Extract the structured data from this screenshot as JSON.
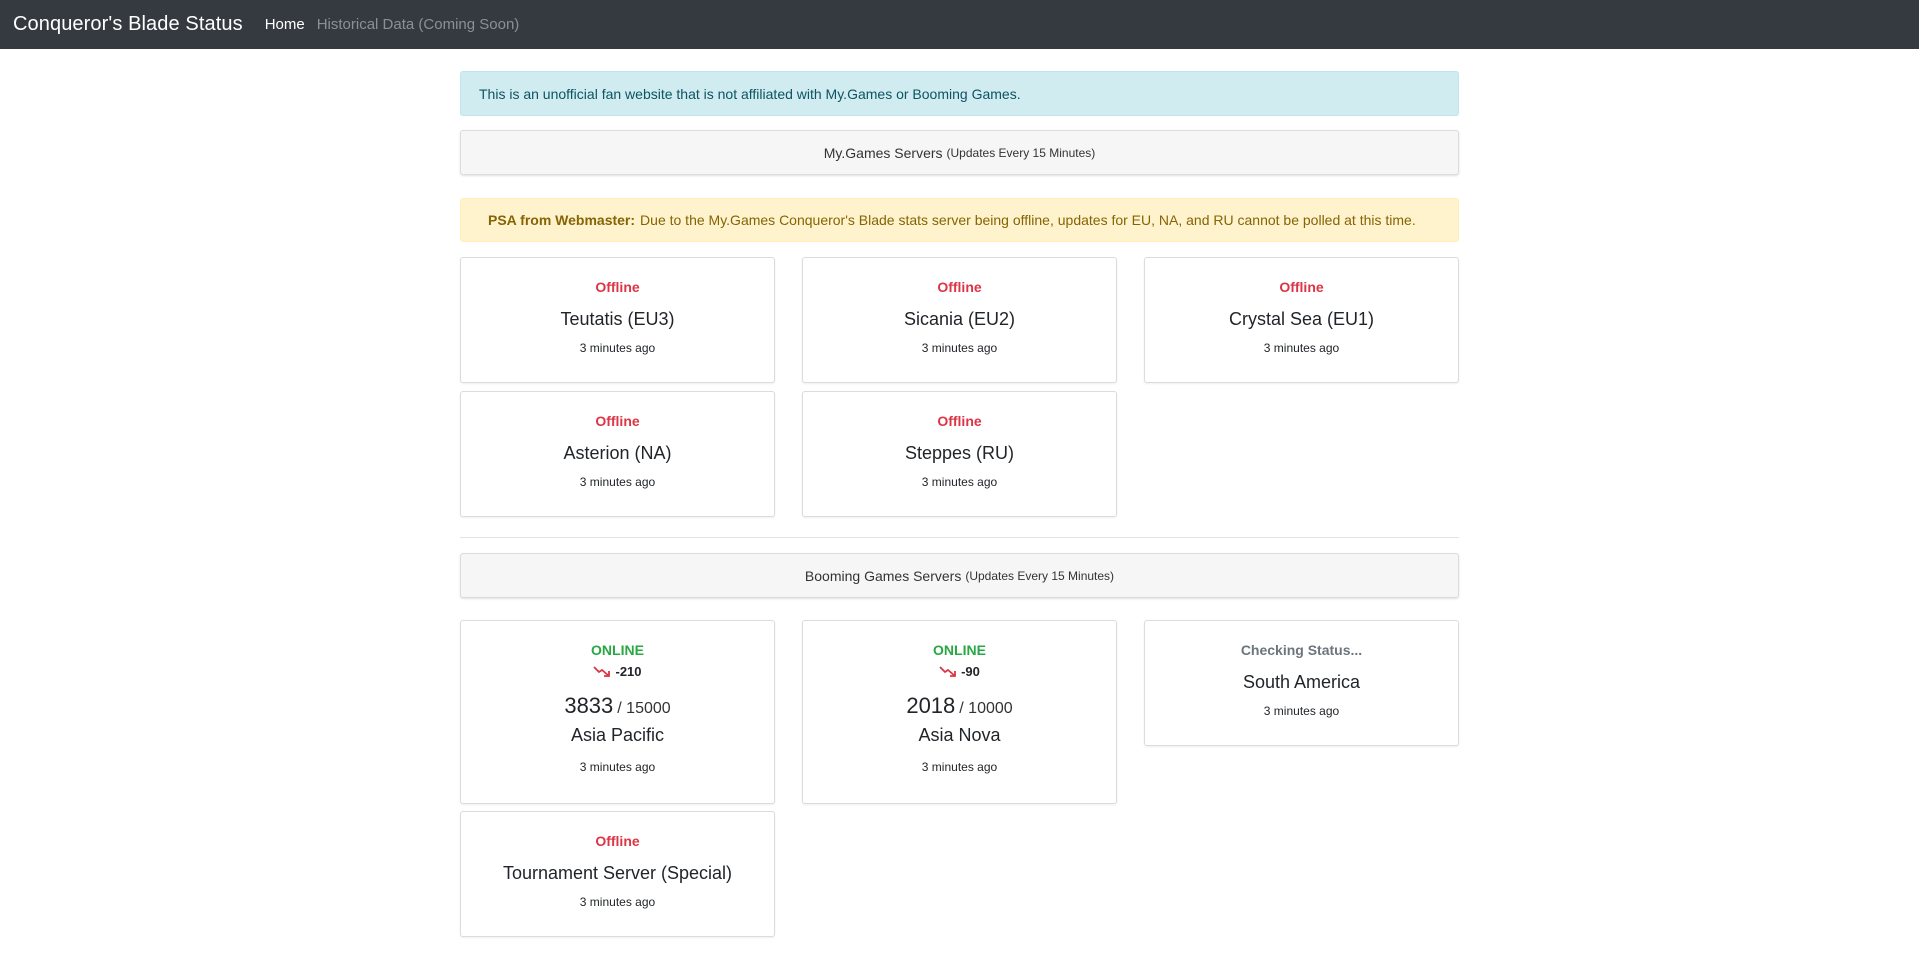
{
  "nav": {
    "brand": "Conqueror's Blade Status",
    "home": "Home",
    "historical": "Historical Data (Coming Soon)"
  },
  "disclaimer": "This is an unofficial fan website that is not affiliated with My.Games or Booming Games.",
  "mygames": {
    "title": "My.Games Servers",
    "subtitle": "(Updates Every 15 Minutes)",
    "psa_label": "PSA from Webmaster:",
    "psa_text": "Due to the My.Games Conqueror's Blade stats server being offline, updates for EU, NA, and RU cannot be polled at this time.",
    "servers": [
      {
        "status": "Offline",
        "name": "Teutatis (EU3)",
        "updated": "3 minutes ago"
      },
      {
        "status": "Offline",
        "name": "Sicania (EU2)",
        "updated": "3 minutes ago"
      },
      {
        "status": "Offline",
        "name": "Crystal Sea (EU1)",
        "updated": "3 minutes ago"
      },
      {
        "status": "Offline",
        "name": "Asterion (NA)",
        "updated": "3 minutes ago"
      },
      {
        "status": "Offline",
        "name": "Steppes (RU)",
        "updated": "3 minutes ago"
      }
    ]
  },
  "booming": {
    "title": "Booming Games Servers",
    "subtitle": "(Updates Every 15 Minutes)",
    "servers": [
      {
        "status": "ONLINE",
        "change": "-210",
        "players": "3833",
        "max": "/ 15000",
        "name": "Asia Pacific",
        "updated": "3 minutes ago"
      },
      {
        "status": "ONLINE",
        "change": "-90",
        "players": "2018",
        "max": "/ 10000",
        "name": "Asia Nova",
        "updated": "3 minutes ago"
      },
      {
        "status": "Checking Status...",
        "name": "South America",
        "updated": "3 minutes ago"
      },
      {
        "status": "Offline",
        "name": "Tournament Server (Special)",
        "updated": "3 minutes ago"
      }
    ]
  },
  "colors": {
    "offline": "#dc3545",
    "online": "#28a745",
    "checking": "#6c757d",
    "trend_down": "#dc3545"
  },
  "icons": {
    "trend": "trending-down-icon"
  }
}
